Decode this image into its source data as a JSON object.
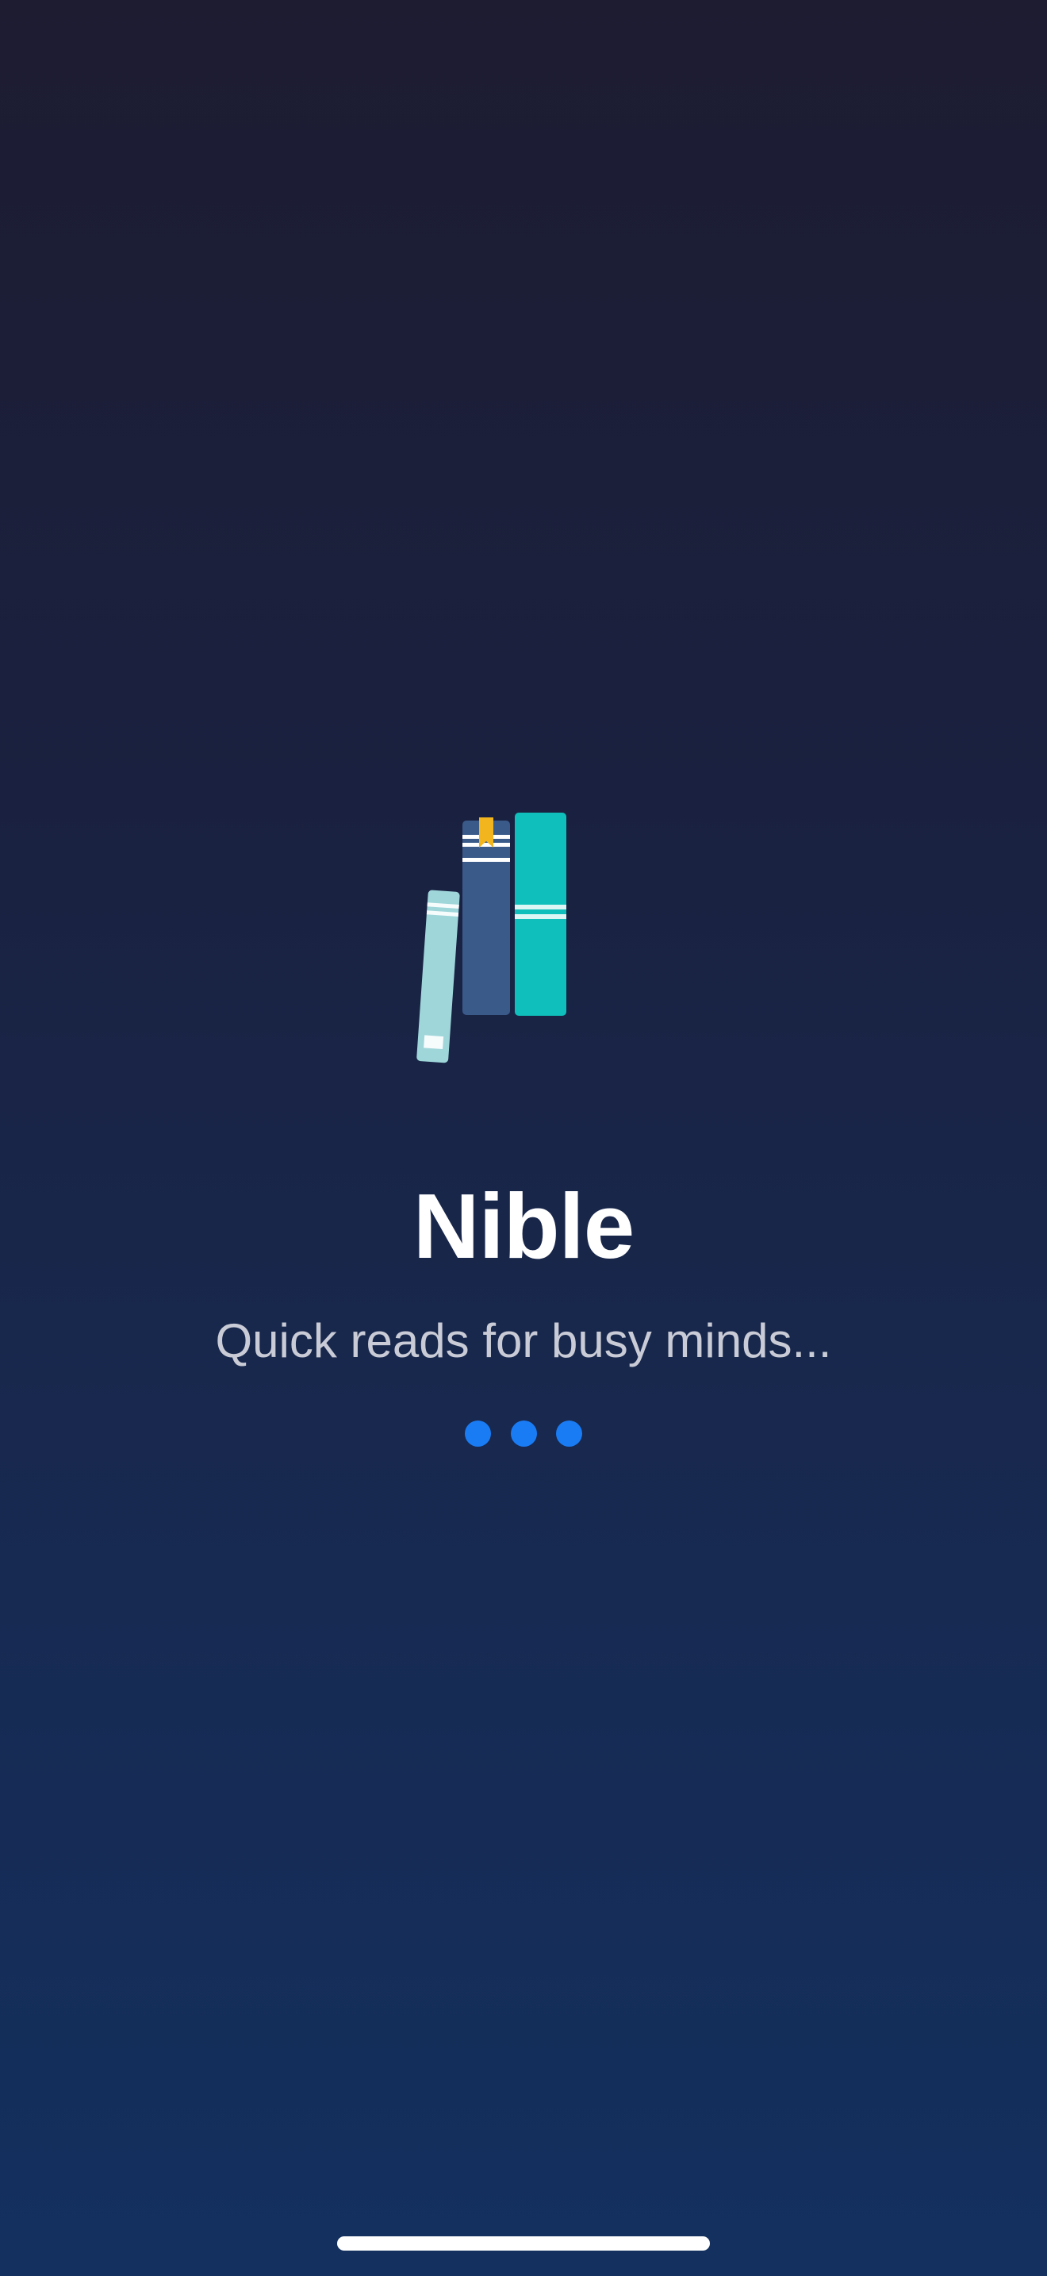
{
  "app": {
    "title": "Nible",
    "tagline": "Quick reads for busy minds..."
  },
  "logo": {
    "icon": "books-stack-icon",
    "colors": {
      "left_book": "#9fd6da",
      "middle_book": "#3a5a8a",
      "right_book": "#0fbfbb",
      "bookmark": "#f2b51e",
      "stripes": "#ffffff"
    }
  },
  "loader": {
    "dot_count": 3,
    "color": "#1a7cf5"
  },
  "theme": {
    "background_top": "#1d1c31",
    "background_bottom": "#13305f",
    "title_color": "#ffffff",
    "tagline_color": "#c9ccd6"
  }
}
